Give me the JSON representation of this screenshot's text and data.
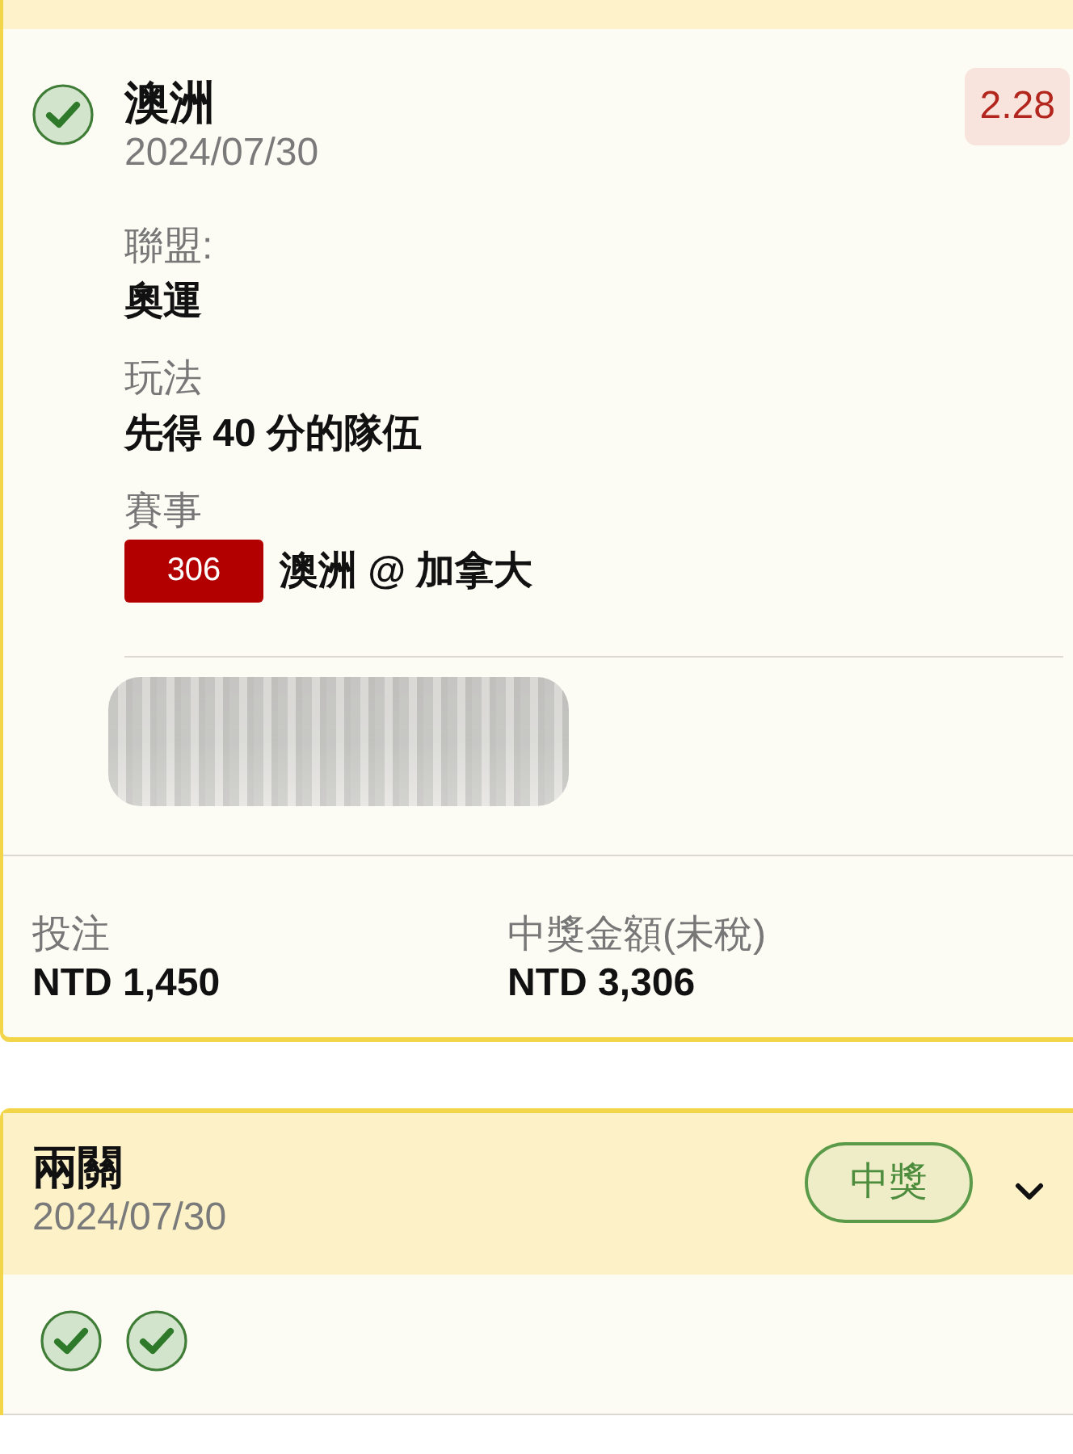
{
  "bet_card": {
    "selection": {
      "won": true,
      "name": "澳洲",
      "date": "2024/07/30",
      "odds": "2.28"
    },
    "details": [
      {
        "kind": "text",
        "label": "聯盟:",
        "value": "奧運"
      },
      {
        "kind": "text",
        "label": "玩法",
        "value": "先得 40 分的隊伍"
      },
      {
        "kind": "event",
        "label": "賽事",
        "event_number": "306",
        "value": "澳洲 @ 加拿大"
      }
    ],
    "summary": [
      {
        "label": "投注",
        "value": "NTD 1,450"
      },
      {
        "label": "中獎金額(未稅)",
        "value": "NTD 3,306"
      }
    ]
  },
  "parlay_card": {
    "title": "兩關",
    "date": "2024/07/30",
    "status": "中獎",
    "expanded": false,
    "legs": [
      {
        "won": true
      },
      {
        "won": true
      }
    ]
  }
}
